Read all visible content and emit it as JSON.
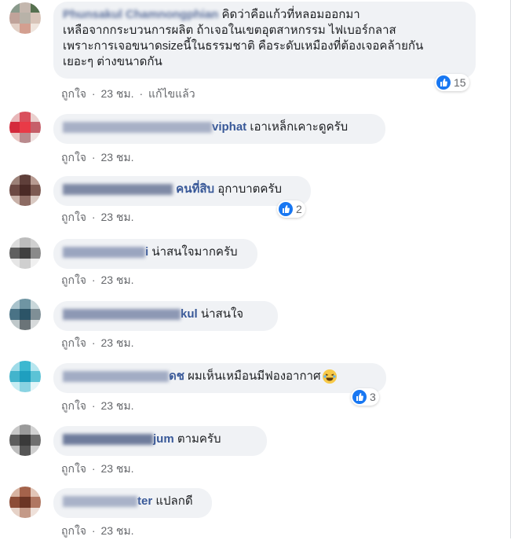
{
  "comments": [
    {
      "name": "Phunsakul Chamnongphian",
      "text": "คิดว่าคือแก้วที่หลอมออกมา",
      "text_lines": [
        "เหลือจากกระบวนการผลิต ถ้าเจอในเขตอุตสาหกรรม ไฟเบอร์กลาส",
        "เพราะการเจอขนาดsizeนี้ในธรรมชาติ คือระดับเหมืองที่ต้องเจอคล้ายกัน",
        "เยอะๆ ต่างขนาดกัน"
      ],
      "like": "ถูกใจ",
      "time": "23 ชม.",
      "edited": "แก้ไขแล้ว",
      "reactions": "15",
      "avatar_colors": [
        "#8a9a8c",
        "#c4b7ae",
        "#56704f",
        "#c0a39a",
        "#b8b2a8",
        "#d8c4b8",
        "#e2d0c6",
        "#d39f90",
        "#efe5dd"
      ]
    },
    {
      "name": "Kanokporn Sirisakulviphat",
      "name_visible": "viphat",
      "text": "เอาเหล็กเคาะดูครับ",
      "like": "ถูกใจ",
      "time": "23 ชม.",
      "avatar_colors": [
        "#e8b7b9",
        "#d94f5c",
        "#ead1cf",
        "#d42a3c",
        "#e93a47",
        "#c65f69",
        "#e9c7c4",
        "#b98a8d",
        "#f0e2e1"
      ]
    },
    {
      "name": "หมอเกียรติ ผู้เชี่ยวชาญ",
      "name_visible": "คนที่สิบ",
      "text": "อุกาบาตครับ",
      "like": "ถูกใจ",
      "time": "23 ชม.",
      "reactions": "2",
      "avatar_colors": [
        "#9c8178",
        "#5f3f3a",
        "#b89b92",
        "#6d4a44",
        "#4a2a26",
        "#7d5a52",
        "#c8b1a8",
        "#8c6b63",
        "#d9c9c2"
      ]
    },
    {
      "name": "Sompong Jaidee",
      "name_visible": "i",
      "text": "น่าสนใจมากครับ",
      "like": "ถูกใจ",
      "time": "23 ชม.",
      "avatar_colors": [
        "#dcdcdc",
        "#bcbcbc",
        "#d0d0d0",
        "#5f5f5f",
        "#404040",
        "#8a8a8a",
        "#e6e6e6",
        "#cfcfcf",
        "#f0f0f0"
      ]
    },
    {
      "name": "Boonsong Sangwankul",
      "name_visible": "kul",
      "text": "น่าสนใจ",
      "like": "ถูกใจ",
      "time": "23 ชม.",
      "avatar_colors": [
        "#a9c3cc",
        "#6f95a3",
        "#c9d7da",
        "#4a7386",
        "#2c5467",
        "#7f8f96",
        "#bfc8ca",
        "#6b7478",
        "#d7dadb"
      ]
    },
    {
      "name": "Wichai Thongkamdech",
      "name_visible": "ดช",
      "text": "ผมเห็นเหมือนมีฟองอากาศ",
      "like": "ถูกใจ",
      "time": "23 ชม.",
      "reactions": "3",
      "avatar_colors": [
        "#9fdbe8",
        "#3cb8d0",
        "#b7e6ef",
        "#43b4cc",
        "#1f9fbf",
        "#5cc3d6",
        "#c7edf3",
        "#8ad3e2",
        "#e2f5f8"
      ]
    },
    {
      "name": "Natthawut Pakangjum",
      "name_visible": "jum",
      "text": "ตามครับ",
      "like": "ถูกใจ",
      "time": "23 ชม.",
      "avatar_colors": [
        "#c8c8c8",
        "#9a9a9a",
        "#d2d2d2",
        "#5d5d5d",
        "#3a3a3a",
        "#6f6f6f",
        "#bdbdbd",
        "#555555",
        "#cfcfcf"
      ]
    },
    {
      "name": "Somchai Rattanater",
      "name_visible": "ter",
      "text": "แปลกดี",
      "like": "ถูกใจ",
      "time": "23 ชม.",
      "avatar_colors": [
        "#d7b3a1",
        "#a4634b",
        "#e2c6b8",
        "#8c4c36",
        "#6b3524",
        "#b07762",
        "#e6d2c7",
        "#c49a88",
        "#efe1da"
      ]
    }
  ]
}
